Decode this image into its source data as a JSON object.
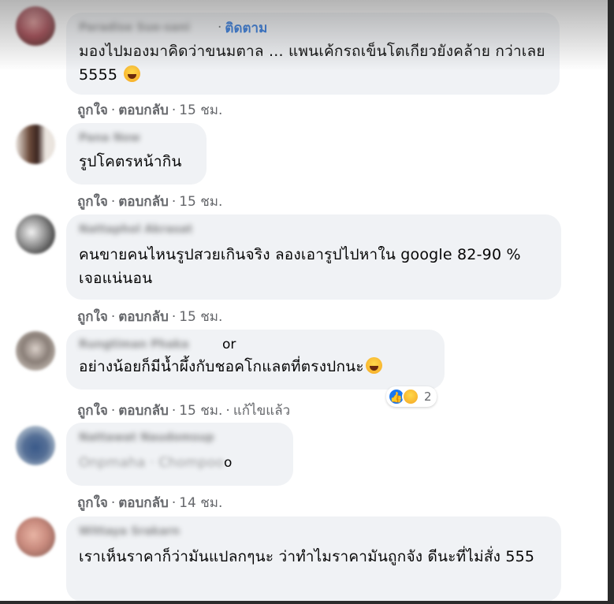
{
  "action_labels": {
    "like": "ถูกใจ",
    "reply": "ตอบกลับ",
    "dot": "·"
  },
  "comments": [
    {
      "author": "Paradise Sue-sani",
      "follow": "ติดตาม",
      "text": "มองไปมองมาคิดว่าขนมตาล ... แพนเค้กรถเข็นโตเกียวยังคล้าย กว่าเลย 5555",
      "emoji": "laughing-tears",
      "time": "15 ชม."
    },
    {
      "author": "Pana Now",
      "text": "รูปโคตรหน้ากิน",
      "time": "15 ชม."
    },
    {
      "author": "Nattaphol Akrasat",
      "text": "คนขายคนไหนรูปสวยเกินจริง ลองเอารูปไปหาใน google 82-90 % เจอแน่นอน",
      "time": "15 ชม."
    },
    {
      "author": "Rungtiman Phaka",
      "author_suffix": "or",
      "text": "อย่างน้อยก็มีน้ำผึ้งกับชอคโกแลตที่ตรงปกนะ",
      "emoji": "laughing-tears",
      "time": "15 ชม.",
      "edited": "แก้ไขแล้ว",
      "reactions": {
        "icons": [
          "like",
          "haha"
        ],
        "count": "2"
      }
    },
    {
      "author": "Nattawat Naudomsup",
      "text": "Onpmaha · Chompoo",
      "text_suffix": "o",
      "time": "14 ชม."
    },
    {
      "author": "Wittaya Srakarn",
      "text": "เราเห็นราคาก็ว่ามันแปลกๆนะ ว่าทำไมราคามันถูกจัง ดีนะที่ไม่สั่ง 555",
      "time": ""
    }
  ]
}
